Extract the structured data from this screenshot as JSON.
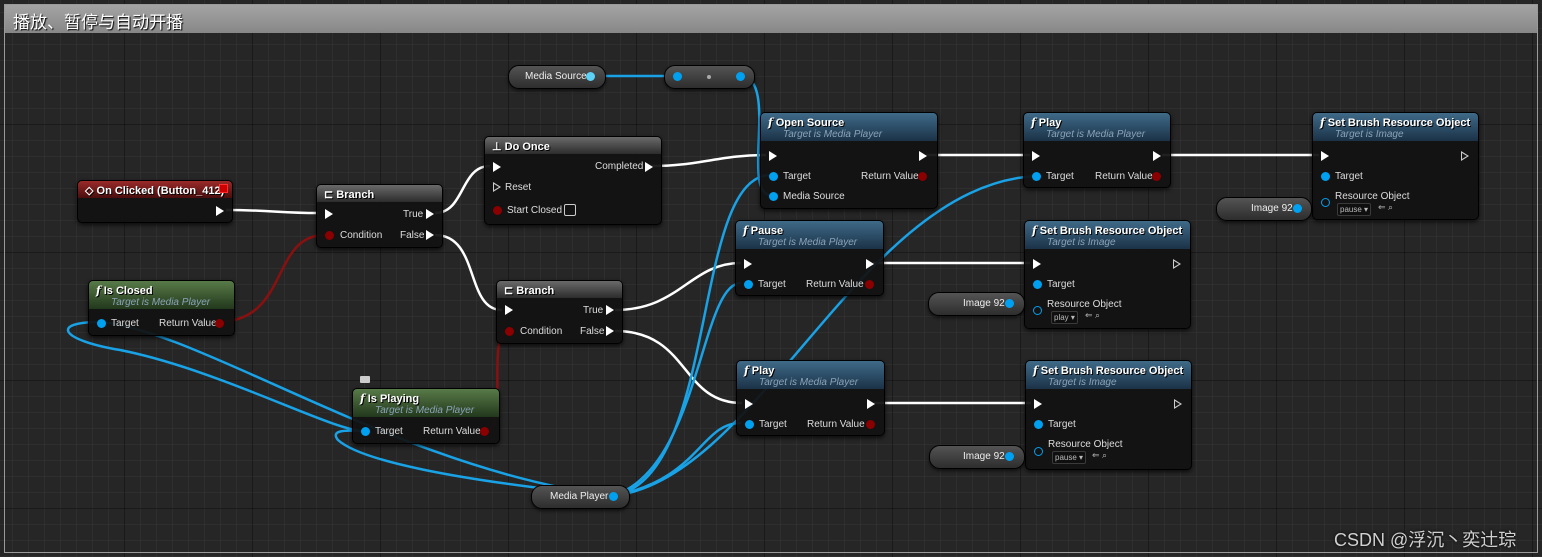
{
  "comment": {
    "title": "播放、暂停与自动开播"
  },
  "colors": {
    "exec_wire": "#ffffff",
    "object_wire": "#19a2e6",
    "bool_wire": "#8a1010",
    "pure_header": "#4a6c3e",
    "function_header": "#2e5574",
    "event_header": "#7a1c1c"
  },
  "nodes": {
    "on_clicked": {
      "title": "On Clicked (Button_412)",
      "icon": "event-diamond-icon"
    },
    "branch1": {
      "title": "Branch",
      "icon": "branch-icon",
      "true": "True",
      "condition": "Condition",
      "false": "False"
    },
    "is_closed": {
      "title": "Is Closed",
      "subtitle": "Target is Media Player",
      "target": "Target",
      "return": "Return Value"
    },
    "do_once": {
      "title": "Do Once",
      "icon": "do-once-icon",
      "completed": "Completed",
      "reset": "Reset",
      "start_closed": "Start Closed"
    },
    "branch2": {
      "title": "Branch",
      "icon": "branch-icon",
      "true": "True",
      "condition": "Condition",
      "false": "False"
    },
    "is_playing": {
      "title": "Is Playing",
      "subtitle": "Target is Media Player",
      "target": "Target",
      "return": "Return Value"
    },
    "media_source_var": {
      "label": "Media Source"
    },
    "media_player_var": {
      "label": "Media Player"
    },
    "open_source": {
      "title": "Open Source",
      "subtitle": "Target is Media Player",
      "target": "Target",
      "return": "Return Value",
      "media_source": "Media Source"
    },
    "pause": {
      "title": "Pause",
      "subtitle": "Target is Media Player",
      "target": "Target",
      "return": "Return Value"
    },
    "play_a": {
      "title": "Play",
      "subtitle": "Target is Media Player",
      "target": "Target",
      "return": "Return Value"
    },
    "play_b": {
      "title": "Play",
      "subtitle": "Target is Media Player",
      "target": "Target",
      "return": "Return Value"
    },
    "set_brush_1": {
      "title": "Set Brush Resource Object",
      "subtitle": "Target is Image",
      "target": "Target",
      "resource": "Resource Object",
      "value": "pause"
    },
    "set_brush_2": {
      "title": "Set Brush Resource Object",
      "subtitle": "Target is Image",
      "target": "Target",
      "resource": "Resource Object",
      "value": "play"
    },
    "set_brush_3": {
      "title": "Set Brush Resource Object",
      "subtitle": "Target is Image",
      "target": "Target",
      "resource": "Resource Object",
      "value": "pause"
    },
    "image_var_1": {
      "label": "Image 92"
    },
    "image_var_2": {
      "label": "Image 92"
    },
    "image_var_3": {
      "label": "Image 92"
    }
  },
  "watermark": "CSDN @浮沉丶奕辻琮"
}
